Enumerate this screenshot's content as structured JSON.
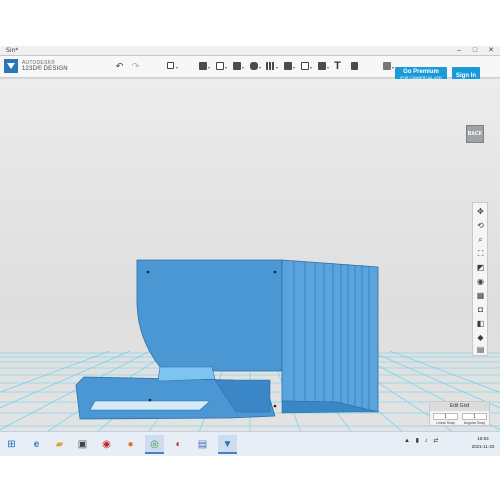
{
  "window": {
    "title": "Sin*"
  },
  "app": {
    "brand_top": "AUTODESK®",
    "brand_bottom": "123D® DESIGN"
  },
  "toolbar": {
    "undo_icon": "undo-icon",
    "redo_icon": "redo-icon",
    "premium": {
      "label": "Go Premium",
      "sublabel": "(FOR COMMERCIAL USE)"
    },
    "signin_label": "Sign In",
    "text_tool_glyph": "T"
  },
  "viewcube": {
    "label": "BACK"
  },
  "edit_grid": {
    "title": "Edit Grid",
    "linear_value": "1",
    "angular_value": "1",
    "linear_label": "Linear Snap",
    "angular_label": "Angular Snap"
  },
  "taskbar": {
    "time": "16:53",
    "date": "2021-11-20"
  },
  "colors": {
    "model_blue": "#4a97d4",
    "grid_cyan": "#3fc6ea",
    "accent": "#1a9ad9"
  }
}
